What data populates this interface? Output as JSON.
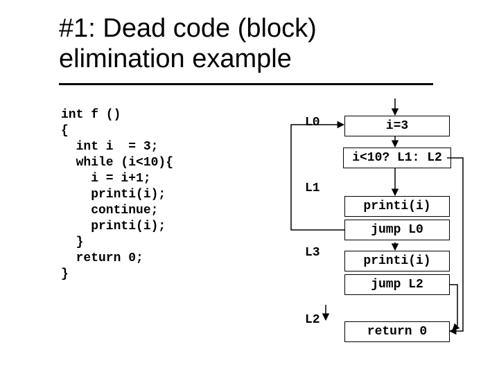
{
  "title_line1": "#1: Dead code (block)",
  "title_line2": "elimination example",
  "code": "int f ()\n{\n  int i  = 3;\n  while (i<10){\n    i = i+1;\n    printi(i);\n    continue;\n    printi(i);\n  }\n  return 0;\n}",
  "labels": {
    "L0": "L0",
    "L1": "L1",
    "L3": "L3",
    "L2": "L2"
  },
  "boxes": {
    "b_i3": "i=3",
    "b_cond": "i<10? L1: L2",
    "b_prn1": "printi(i)",
    "b_jmp0": "jump L0",
    "b_prn2": "printi(i)",
    "b_jmp2": "jump L2",
    "b_ret": "return 0"
  }
}
